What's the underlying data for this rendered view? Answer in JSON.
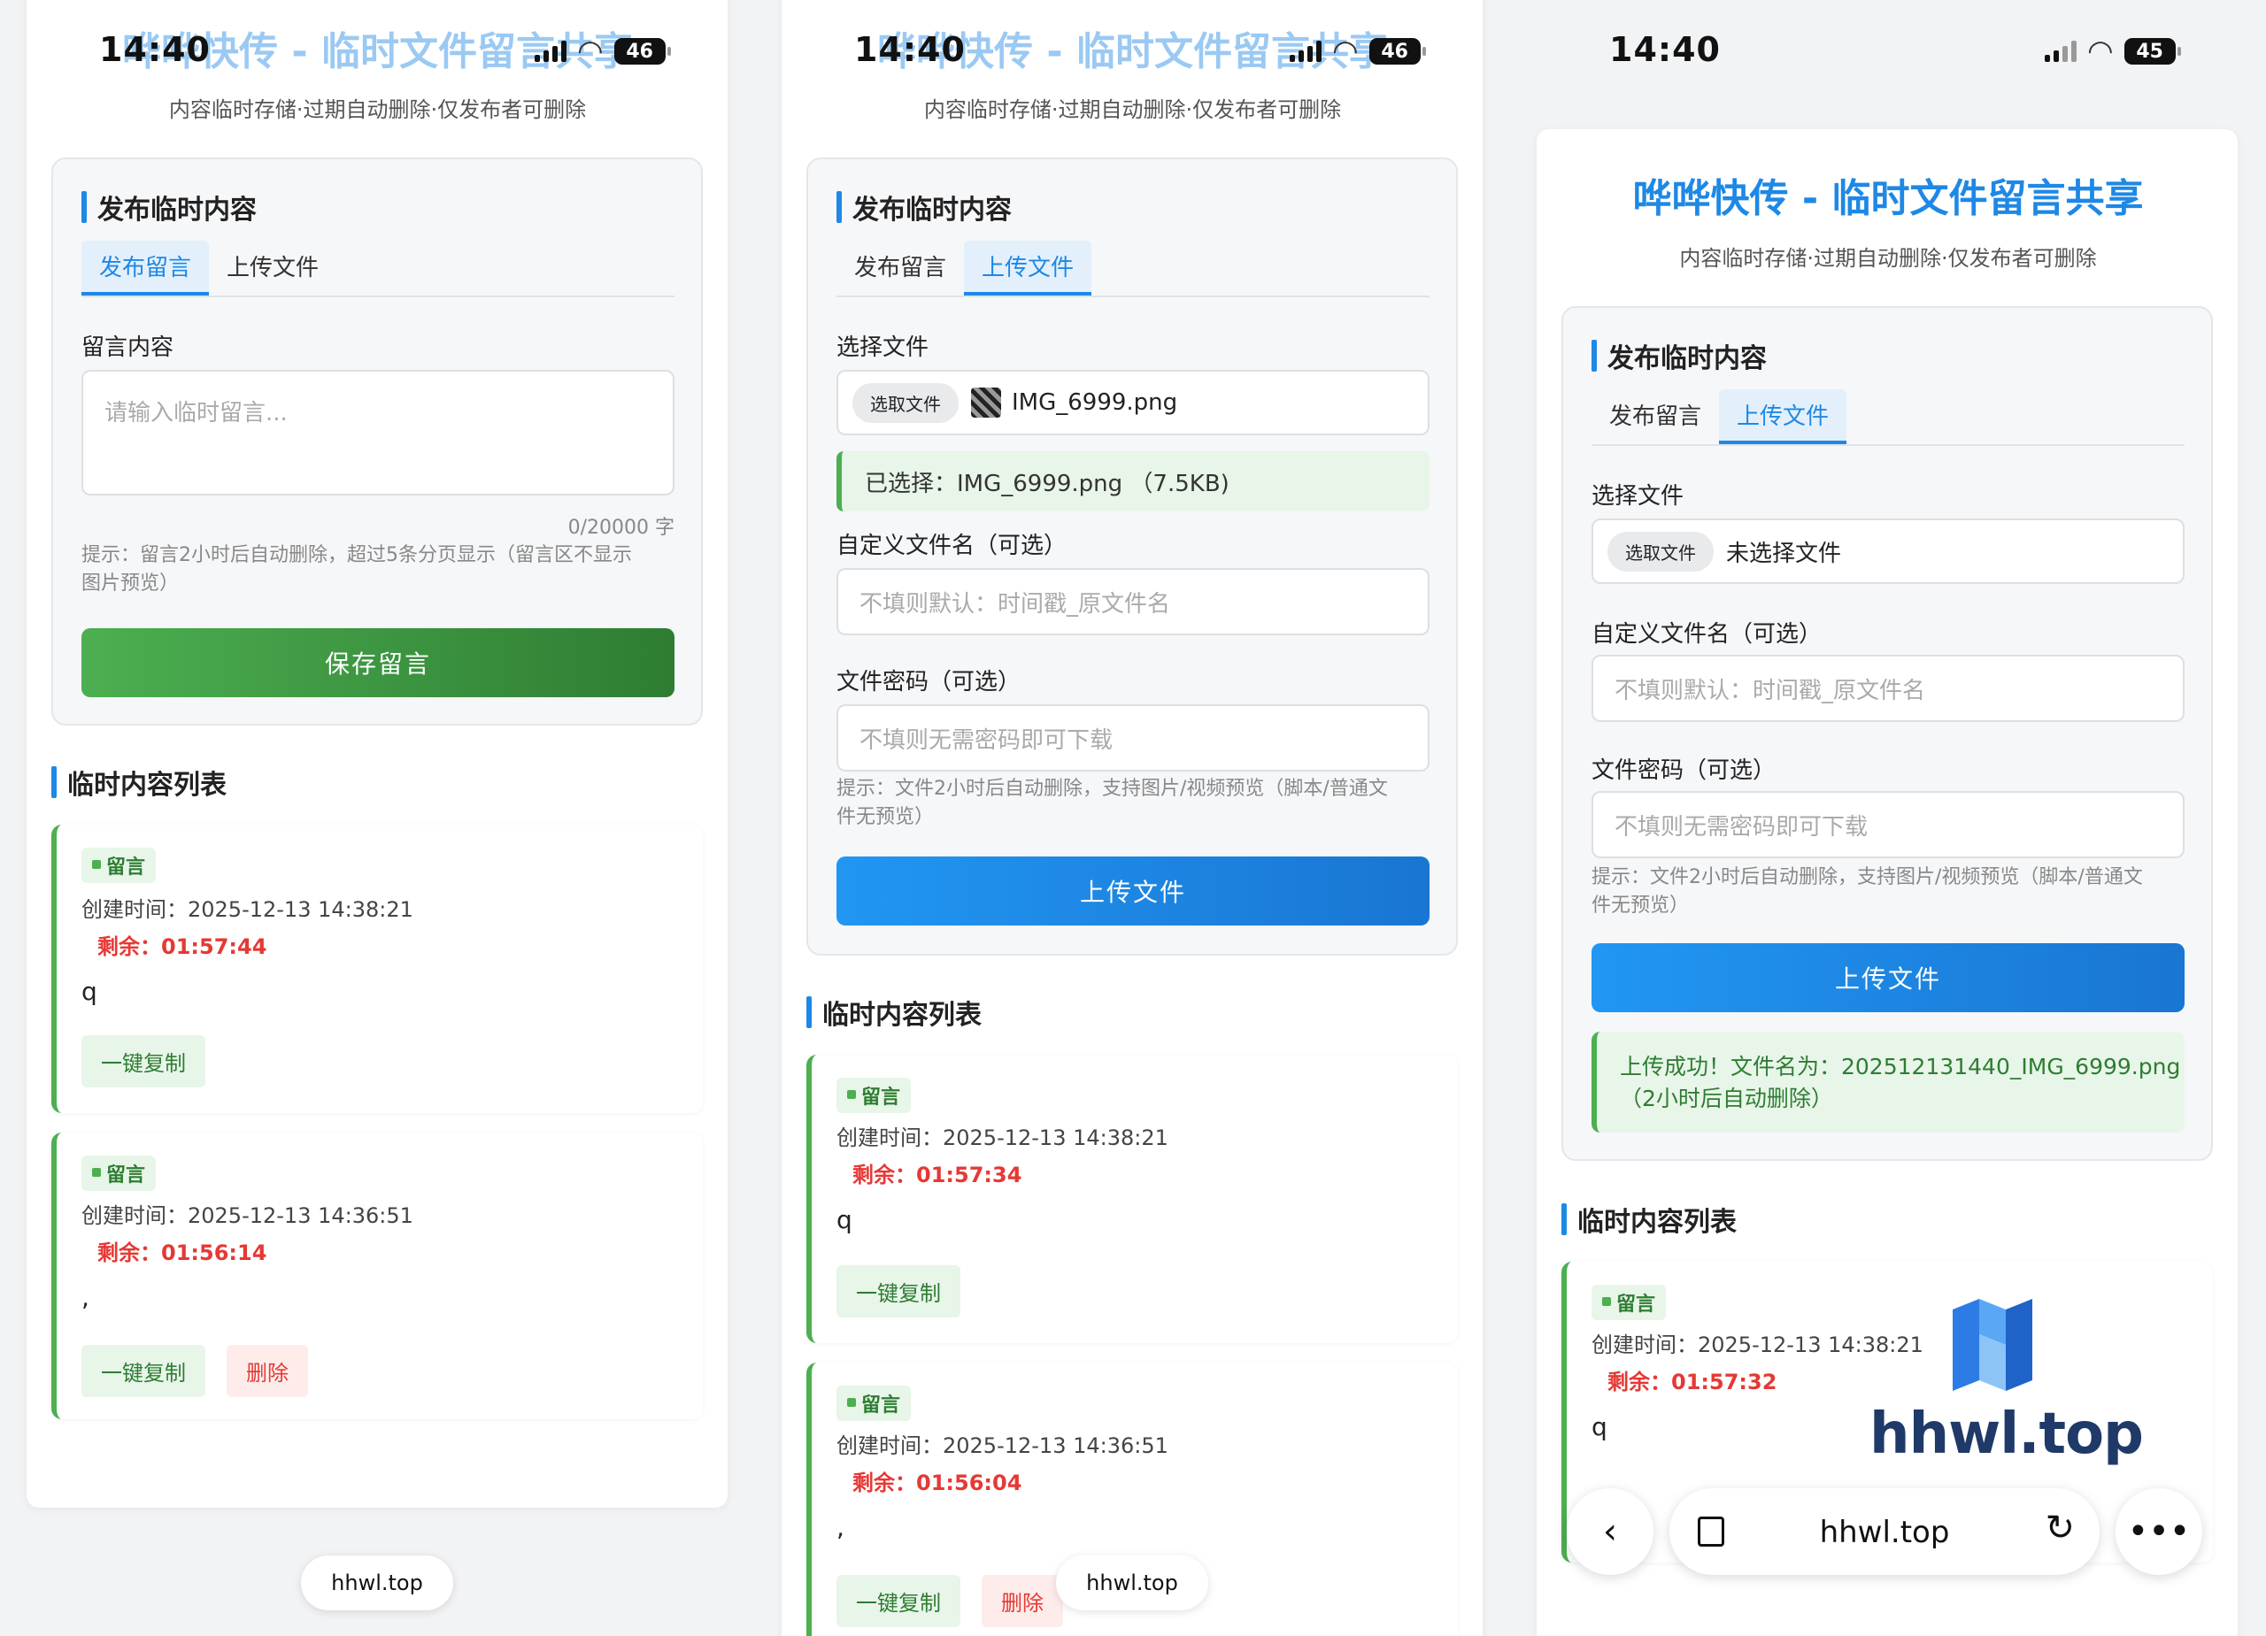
{
  "app": {
    "title": "哗哗快传 - 临时文件留言共享",
    "subtitle": "内容临时存储·过期自动删除·仅发布者可删除"
  },
  "phones": [
    {
      "status": {
        "time": "14:40",
        "battery": "46"
      },
      "section_title": "发布临时内容",
      "tabs": [
        "发布留言",
        "上传文件"
      ],
      "active_tab": 0,
      "message_label": "留言内容",
      "message_placeholder": "请输入临时留言...",
      "counter": "0/20000 字",
      "hint_line1": "提示：留言2小时后自动删除，超过5条分页显示（留言区不显示",
      "hint_line2": "图片预览）",
      "save_button": "保存留言",
      "list_title": "临时内容列表",
      "items": [
        {
          "badge": "留言",
          "created": "创建时间：2025-12-13 14:38:21",
          "remain": "剩余：01:57:44",
          "content": "q",
          "copy": "一键复制"
        },
        {
          "badge": "留言",
          "created": "创建时间：2025-12-13 14:36:51",
          "remain": "剩余：01:56:14",
          "content": ",",
          "copy": "一键复制",
          "delete": "删除"
        }
      ],
      "url": "hhwl.top"
    },
    {
      "status": {
        "time": "14:40",
        "battery": "46"
      },
      "section_title": "发布临时内容",
      "tabs": [
        "发布留言",
        "上传文件"
      ],
      "active_tab": 1,
      "file_label": "选择文件",
      "file_button": "选取文件",
      "file_name": "IMG_6999.png",
      "selected_note": "已选择：IMG_6999.png （7.5KB)",
      "custom_name_label": "自定义文件名（可选）",
      "custom_name_placeholder": "不填则默认：时间戳_原文件名",
      "password_label": "文件密码（可选）",
      "password_placeholder": "不填则无需密码即可下载",
      "hint_line1": "提示：文件2小时后自动删除，支持图片/视频预览（脚本/普通文",
      "hint_line2": "件无预览）",
      "upload_button": "上传文件",
      "list_title": "临时内容列表",
      "items": [
        {
          "badge": "留言",
          "created": "创建时间：2025-12-13 14:38:21",
          "remain": "剩余：01:57:34",
          "content": "q",
          "copy": "一键复制"
        },
        {
          "badge": "留言",
          "created": "创建时间：2025-12-13 14:36:51",
          "remain": "剩余：01:56:04",
          "content": ",",
          "copy": "一键复制",
          "delete": "删除"
        }
      ],
      "url": "hhwl.top"
    },
    {
      "status": {
        "time": "14:40",
        "battery": "45"
      },
      "section_title": "发布临时内容",
      "tabs": [
        "发布留言",
        "上传文件"
      ],
      "active_tab": 1,
      "file_label": "选择文件",
      "file_button": "选取文件",
      "file_name": "未选择文件",
      "custom_name_label": "自定义文件名（可选）",
      "custom_name_placeholder": "不填则默认：时间戳_原文件名",
      "password_label": "文件密码（可选）",
      "password_placeholder": "不填则无需密码即可下载",
      "hint_line1": "提示：文件2小时后自动删除，支持图片/视频预览（脚本/普通文",
      "hint_line2": "件无预览）",
      "upload_button": "上传文件",
      "success_line1": "上传成功！文件名为：202512131440_IMG_6999.png",
      "success_line2": "（2小时后自动删除）",
      "list_title": "临时内容列表",
      "items": [
        {
          "badge": "留言",
          "created": "创建时间：2025-12-13 14:38:21",
          "remain": "剩余：01:57:32",
          "content": "q"
        }
      ],
      "url": "hhwl.top"
    }
  ],
  "watermark": "hhwl.top",
  "colors": {
    "accent": "#1e88e5",
    "success": "#4caf50",
    "danger": "#e53935"
  }
}
